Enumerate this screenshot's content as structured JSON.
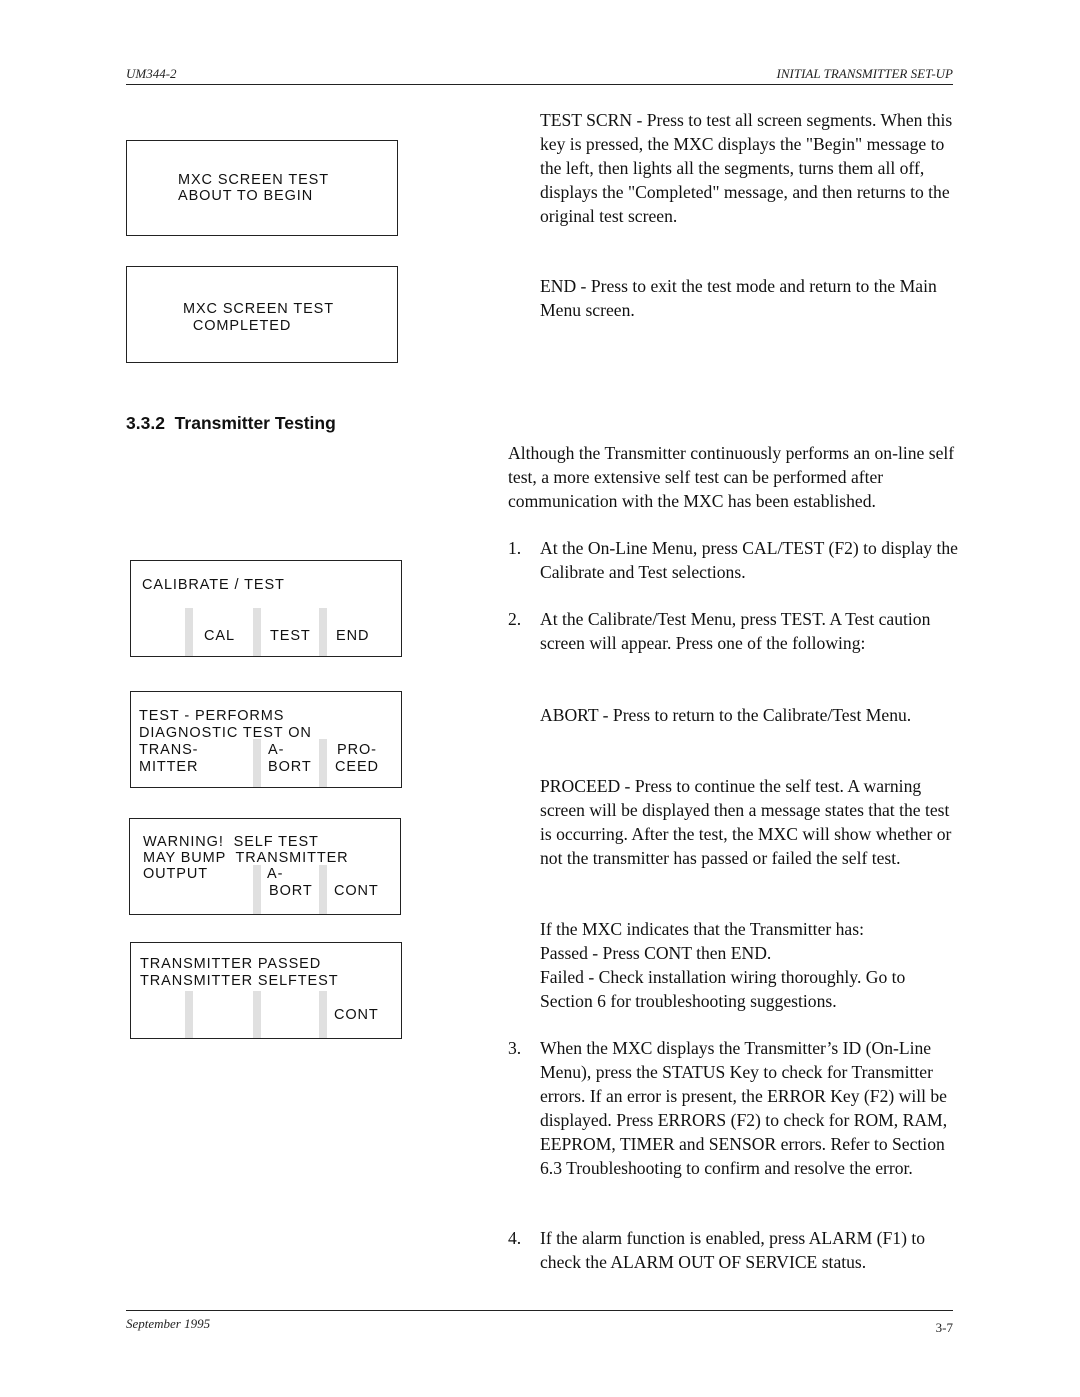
{
  "header": {
    "doc_id": "UM344-2",
    "section_title": "INITIAL TRANSMITTER SET-UP"
  },
  "footer": {
    "date": "September 1995",
    "page_number": "3-7"
  },
  "lcd_screens": {
    "screen_test_begin": {
      "line1": "MXC SCREEN TEST",
      "line2": "ABOUT TO BEGIN"
    },
    "screen_test_completed": {
      "line1": "MXC SCREEN TEST",
      "line2": "  COMPLETED"
    },
    "calibrate_test": {
      "title": "CALIBRATE / TEST",
      "keys": [
        "",
        "CAL",
        "TEST",
        "END"
      ]
    },
    "test_performs": {
      "line1": "TEST - PERFORMS",
      "line2": "DIAGNOSTIC TEST ON",
      "label_col": [
        "TRANS-",
        "MITTER"
      ],
      "keys": [
        [
          "A-",
          "BORT"
        ],
        [
          "PRO-",
          "CEED"
        ]
      ]
    },
    "warning": {
      "line1": "WARNING!  SELF TEST",
      "line2": "MAY BUMP  TRANSMITTER",
      "line3": "OUTPUT",
      "keys": [
        [
          "A-",
          "BORT"
        ],
        [
          "",
          "CONT"
        ]
      ]
    },
    "passed": {
      "line1": "TRANSMITTER PASSED",
      "line2": "TRANSMITTER SELFTEST",
      "keys": [
        "",
        "",
        "",
        "CONT"
      ]
    }
  },
  "intro": {
    "test_scrn": "TEST SCRN - Press to test all screen segments. When this key is pressed, the MXC displays the \"Begin\" message to the left, then lights all the segments, turns them all off, displays the \"Completed\" message, and then returns to the original test screen.",
    "end": "END - Press to exit the test mode and return to the Main Menu screen."
  },
  "section": {
    "number": "3.3.2",
    "title": "Transmitter Testing",
    "intro": "Although the Transmitter continuously performs an on-line self test, a more extensive self test can be performed after communication with the MXC has been established.",
    "steps": [
      {
        "num": "1.",
        "text": "At the On-Line Menu, press CAL/TEST (F2) to display the Calibrate and Test selections."
      },
      {
        "num": "2.",
        "text": "At the Calibrate/Test Menu, press TEST.  A Test caution screen will appear.  Press one of the following:"
      },
      {
        "num": "3.",
        "text": "When the MXC displays the Transmitter’s ID (On-Line Menu), press the STATUS Key to check for Transmitter errors.  If an error is present, the ERROR Key (F2) will be displayed.  Press ERRORS (F2) to check for ROM, RAM, EEPROM, TIMER and SENSOR errors.  Refer to Section 6.3 Troubleshooting to confirm and resolve the error."
      },
      {
        "num": "4.",
        "text": "If the alarm function is enabled, press ALARM (F1) to check the ALARM OUT OF SERVICE status."
      }
    ],
    "abort": "ABORT - Press to return to the Calibrate/Test Menu.",
    "proceed": "PROCEED - Press to continue the self test.  A warning screen will be displayed then a message states that the test is occurring.  After the test, the MXC will show whether or not the transmitter has passed or failed the self test.",
    "result_intro": "If the MXC indicates that the Transmitter has:",
    "passed": "Passed - Press CONT then END.",
    "failed": "Failed -  Check installation wiring thoroughly.  Go to Section 6 for troubleshooting suggestions."
  }
}
